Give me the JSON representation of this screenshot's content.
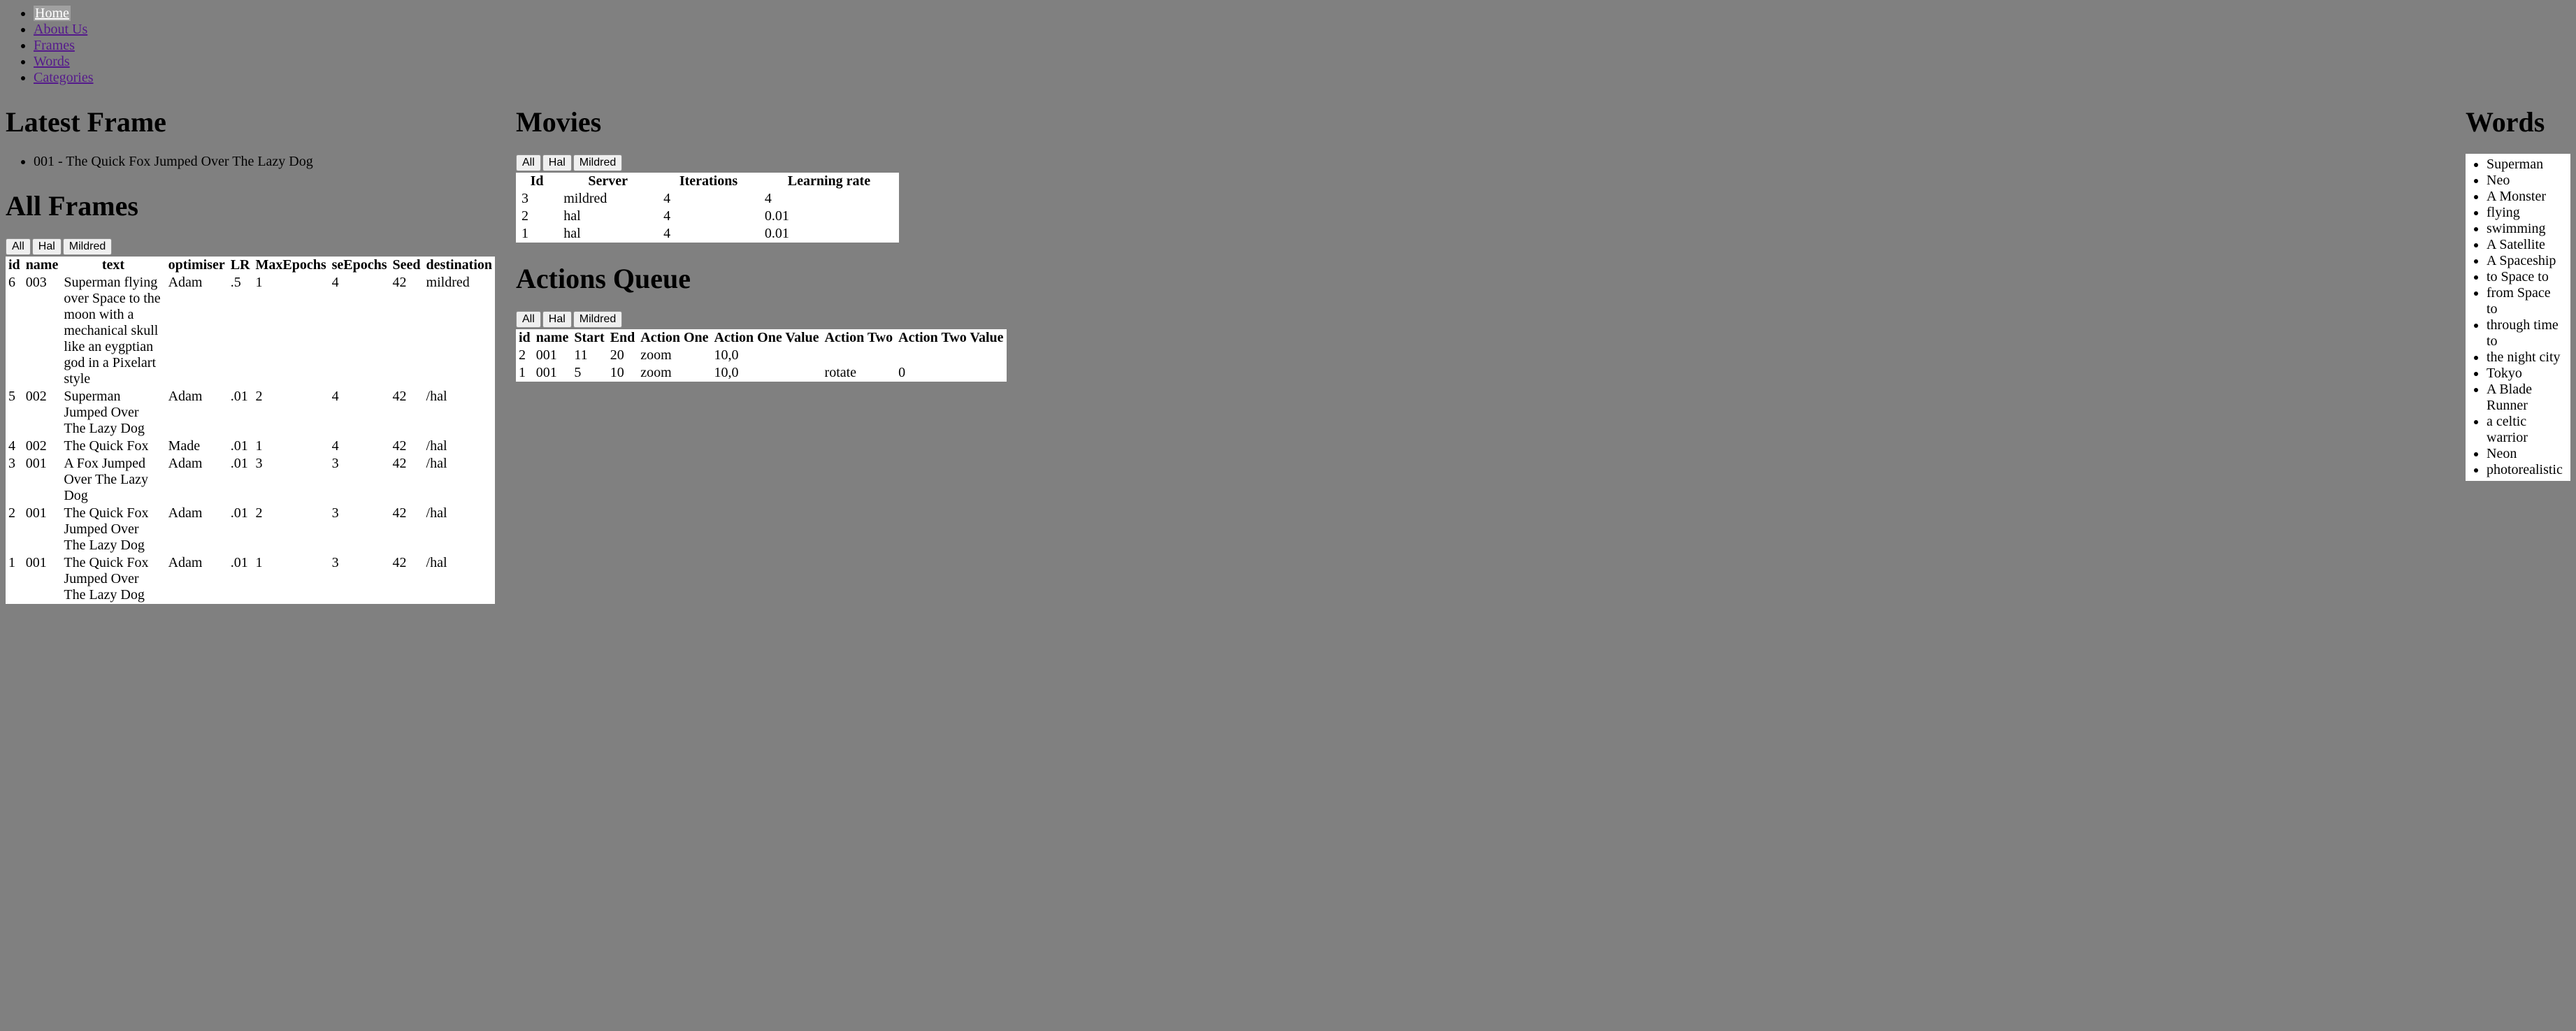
{
  "nav": [
    {
      "label": "Home",
      "active": true
    },
    {
      "label": "About Us",
      "active": false
    },
    {
      "label": "Frames",
      "active": false
    },
    {
      "label": "Words",
      "active": false
    },
    {
      "label": "Categories",
      "active": false
    }
  ],
  "headings": {
    "latest_frame": "Latest Frame",
    "all_frames": "All Frames",
    "movies": "Movies",
    "actions_queue": "Actions Queue",
    "words": "Words"
  },
  "latest_frame": "001 - The Quick Fox Jumped Over The Lazy Dog",
  "filter_buttons": [
    "All",
    "Hal",
    "Mildred"
  ],
  "frames": {
    "headers": [
      "id",
      "name",
      "text",
      "optimiser",
      "LR",
      "MaxEpochs",
      "seEpochs",
      "Seed",
      "destination"
    ],
    "rows": [
      {
        "id": "6",
        "name": "003",
        "text": "Superman flying over Space to the moon with a mechanical skull like an eygptian god in a Pixelart style",
        "optimiser": "Adam",
        "lr": ".5",
        "maxepochs": "1",
        "seepochs": "4",
        "seed": "42",
        "destination": "mildred"
      },
      {
        "id": "5",
        "name": "002",
        "text": "Superman Jumped Over The Lazy Dog",
        "optimiser": "Adam",
        "lr": ".01",
        "maxepochs": "2",
        "seepochs": "4",
        "seed": "42",
        "destination": "/hal"
      },
      {
        "id": "4",
        "name": "002",
        "text": "The Quick Fox",
        "optimiser": "Made",
        "lr": ".01",
        "maxepochs": "1",
        "seepochs": "4",
        "seed": "42",
        "destination": "/hal"
      },
      {
        "id": "3",
        "name": "001",
        "text": "A Fox Jumped Over The Lazy Dog",
        "optimiser": "Adam",
        "lr": ".01",
        "maxepochs": "3",
        "seepochs": "3",
        "seed": "42",
        "destination": "/hal"
      },
      {
        "id": "2",
        "name": "001",
        "text": "The Quick Fox Jumped Over The Lazy Dog",
        "optimiser": "Adam",
        "lr": ".01",
        "maxepochs": "2",
        "seepochs": "3",
        "seed": "42",
        "destination": "/hal"
      },
      {
        "id": "1",
        "name": "001",
        "text": "The Quick Fox Jumped Over The Lazy Dog",
        "optimiser": "Adam",
        "lr": ".01",
        "maxepochs": "1",
        "seepochs": "3",
        "seed": "42",
        "destination": "/hal"
      }
    ]
  },
  "movies": {
    "headers": [
      "Id",
      "Server",
      "Iterations",
      "Learning rate"
    ],
    "rows": [
      {
        "id": "3",
        "server": "mildred",
        "iterations": "4",
        "lr": "4"
      },
      {
        "id": "2",
        "server": "hal",
        "iterations": "4",
        "lr": "0.01"
      },
      {
        "id": "1",
        "server": "hal",
        "iterations": "4",
        "lr": "0.01"
      }
    ]
  },
  "actions": {
    "headers": [
      "id",
      "name",
      "Start",
      "End",
      "Action One",
      "Action One Value",
      "Action Two",
      "Action Two Value"
    ],
    "rows": [
      {
        "id": "2",
        "name": "001",
        "start": "11",
        "end": "20",
        "a1": "zoom",
        "a1v": "10,0",
        "a2": "",
        "a2v": ""
      },
      {
        "id": "1",
        "name": "001",
        "start": "5",
        "end": "10",
        "a1": "zoom",
        "a1v": "10,0",
        "a2": "rotate",
        "a2v": "0"
      }
    ]
  },
  "words": [
    "Superman",
    "Neo",
    "A Monster",
    "flying",
    "swimming",
    "A Satellite",
    "A Spaceship",
    "to Space to",
    "from Space to",
    "through time to",
    "the night city",
    "Tokyo",
    "A Blade Runner",
    "a celtic warrior",
    "Neon",
    "photorealistic"
  ]
}
